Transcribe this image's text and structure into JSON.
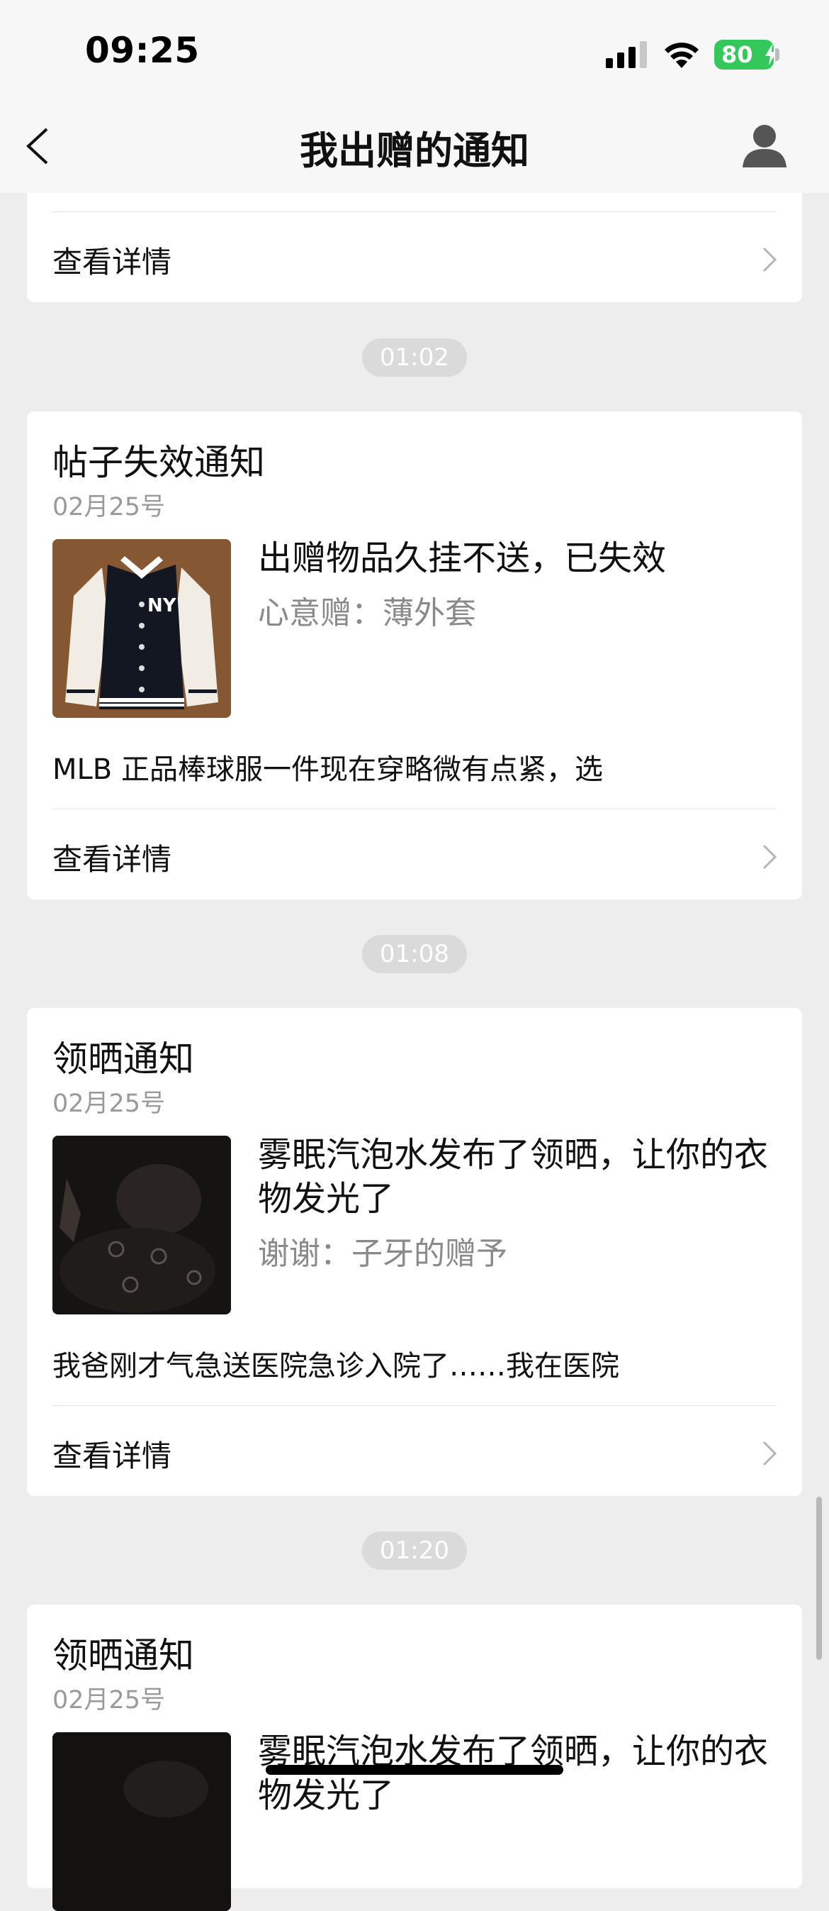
{
  "status_bar": {
    "time": "09:25",
    "battery": "80"
  },
  "nav": {
    "title": "我出赠的通知"
  },
  "detail_label": "查看详情",
  "timestamps": [
    "01:02",
    "01:08",
    "01:20"
  ],
  "cards": [
    {
      "title": "帖子失效通知",
      "date": "02月25号",
      "main": "出赠物品久挂不送，已失效",
      "sub": "心意赠：薄外套",
      "body": "MLB 正品棒球服一件现在穿略微有点紧，选"
    },
    {
      "title": "领晒通知",
      "date": "02月25号",
      "main": "雾眠汽泡水发布了领晒，让你的衣物发光了",
      "sub": "谢谢：子牙的赠予",
      "body": "我爸刚才气急送医院急诊入院了……我在医院"
    },
    {
      "title": "领晒通知",
      "date": "02月25号",
      "main": "雾眠汽泡水发布了领晒，让你的衣物发光了"
    }
  ],
  "icons": {
    "back": "chevron-left-icon",
    "avatar": "user-avatar-icon",
    "chevron": "chevron-right-icon"
  }
}
